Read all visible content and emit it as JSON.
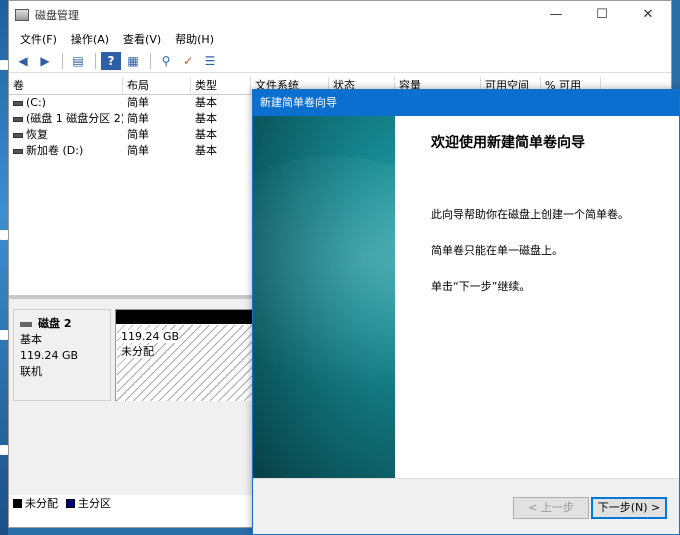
{
  "window": {
    "title": "磁盘管理",
    "controls": {
      "minimize": "—",
      "maximize": "☐",
      "close": "✕"
    }
  },
  "menu": [
    "文件(F)",
    "操作(A)",
    "查看(V)",
    "帮助(H)"
  ],
  "toolbar": {
    "icons": [
      "back-arrow-icon",
      "forward-arrow-icon",
      "console-tree-icon",
      "help-icon",
      "properties-icon",
      "connect-icon",
      "check-icon",
      "details-icon"
    ]
  },
  "volume_table": {
    "columns": [
      "卷",
      "布局",
      "类型",
      "文件系统",
      "状态",
      "容量",
      "可用空间",
      "% 可用"
    ],
    "rows": [
      {
        "name": "(C:)",
        "layout": "简单",
        "type": "基本"
      },
      {
        "name": "(磁盘 1 磁盘分区 2)",
        "layout": "简单",
        "type": "基本"
      },
      {
        "name": "恢复",
        "layout": "简单",
        "type": "基本"
      },
      {
        "name": "新加卷 (D:)",
        "layout": "简单",
        "type": "基本"
      }
    ]
  },
  "disk": {
    "name": "磁盘 2",
    "type": "基本",
    "size": "119.24 GB",
    "status": "联机",
    "partition": {
      "size": "119.24 GB",
      "state": "未分配"
    }
  },
  "legend": [
    {
      "label": "未分配",
      "color": "#000000"
    },
    {
      "label": "主分区",
      "color": "#000080"
    }
  ],
  "wizard": {
    "title": "新建简单卷向导",
    "heading": "欢迎使用新建简单卷向导",
    "paragraphs": [
      "此向导帮助你在磁盘上创建一个简单卷。",
      "简单卷只能在单一磁盘上。",
      "单击“下一步”继续。"
    ],
    "prev_label": "< 上一步",
    "next_label": "下一步(N) >"
  }
}
